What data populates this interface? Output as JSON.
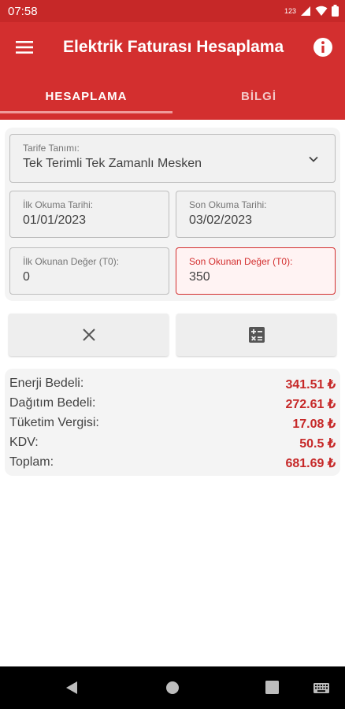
{
  "status_bar": {
    "time": "07:58",
    "network_label": "123"
  },
  "app_bar": {
    "title": "Elektrik Faturası Hesaplama"
  },
  "tabs": [
    {
      "label": "HESAPLAMA",
      "active": true
    },
    {
      "label": "BİLGİ",
      "active": false
    }
  ],
  "form": {
    "tariff": {
      "label": "Tarife Tanımı:",
      "value": "Tek Terimli Tek Zamanlı Mesken"
    },
    "first_date": {
      "label": "İlk Okuma Tarihi:",
      "value": "01/01/2023"
    },
    "last_date": {
      "label": "Son Okuma Tarihi:",
      "value": "03/02/2023"
    },
    "first_value": {
      "label": "İlk Okunan Değer (T0):",
      "value": "0"
    },
    "last_value": {
      "label": "Son Okunan Değer (T0):",
      "value": "350"
    }
  },
  "results": [
    {
      "label": "Enerji Bedeli:",
      "value": "341.51 ₺"
    },
    {
      "label": "Dağıtım Bedeli:",
      "value": "272.61 ₺"
    },
    {
      "label": "Tüketim Vergisi:",
      "value": "17.08 ₺"
    },
    {
      "label": "KDV:",
      "value": "50.5 ₺"
    },
    {
      "label": "Toplam:",
      "value": "681.69 ₺"
    }
  ],
  "colors": {
    "primary": "#d32f2f",
    "status_bar": "#c62828",
    "accent_value": "#c62828",
    "error_border": "#d32f2f"
  },
  "icons": [
    "menu-icon",
    "info-icon",
    "chevron-down-icon",
    "close-icon",
    "calculator-icon",
    "back-icon",
    "home-icon",
    "recents-icon",
    "keyboard-icon"
  ]
}
